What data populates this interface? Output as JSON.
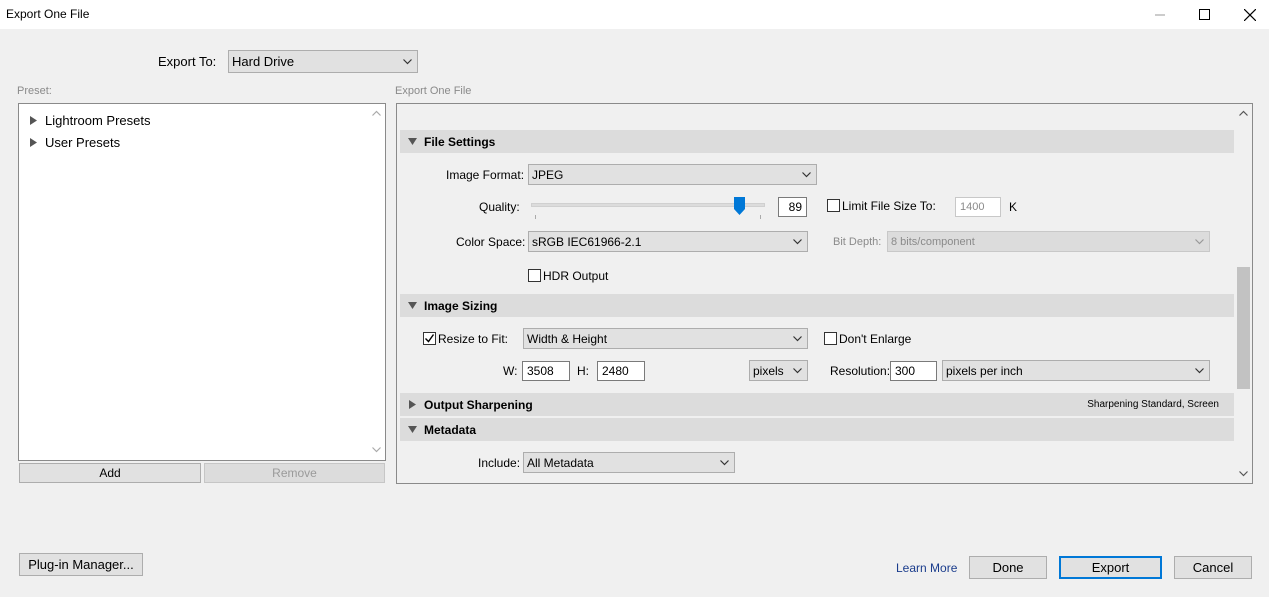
{
  "window": {
    "title": "Export One File"
  },
  "export_to": {
    "label": "Export To:",
    "value": "Hard Drive"
  },
  "preset": {
    "label": "Preset:",
    "items": [
      {
        "label": "Lightroom Presets"
      },
      {
        "label": "User Presets"
      }
    ],
    "add_label": "Add",
    "remove_label": "Remove"
  },
  "panel": {
    "label": "Export One File"
  },
  "file_settings": {
    "header": "File Settings",
    "image_format_label": "Image Format:",
    "image_format_value": "JPEG",
    "quality_label": "Quality:",
    "quality_value": "89",
    "quality_fraction": 0.89,
    "limit_label": "Limit File Size To:",
    "limit_value": "1400",
    "limit_unit": "K",
    "color_space_label": "Color Space:",
    "color_space_value": "sRGB IEC61966-2.1",
    "bit_depth_label": "Bit Depth:",
    "bit_depth_value": "8 bits/component",
    "hdr_label": "HDR Output"
  },
  "image_sizing": {
    "header": "Image Sizing",
    "resize_label": "Resize to Fit:",
    "resize_value": "Width & Height",
    "dont_enlarge_label": "Don't Enlarge",
    "w_label": "W:",
    "w_value": "3508",
    "h_label": "H:",
    "h_value": "2480",
    "unit_value": "pixels",
    "resolution_label": "Resolution:",
    "resolution_value": "300",
    "resolution_unit_value": "pixels per inch"
  },
  "output_sharpening": {
    "header": "Output Sharpening",
    "summary": "Sharpening Standard, Screen"
  },
  "metadata": {
    "header": "Metadata",
    "include_label": "Include:",
    "include_value": "All Metadata"
  },
  "footer": {
    "plugin_manager_label": "Plug-in Manager...",
    "learn_more_label": "Learn More",
    "done_label": "Done",
    "export_label": "Export",
    "cancel_label": "Cancel"
  },
  "colors": {
    "accent": "#0078d7",
    "link": "#1a3c8c",
    "section_bg": "#dcdcdc",
    "window_bg": "#f0f0f0"
  }
}
